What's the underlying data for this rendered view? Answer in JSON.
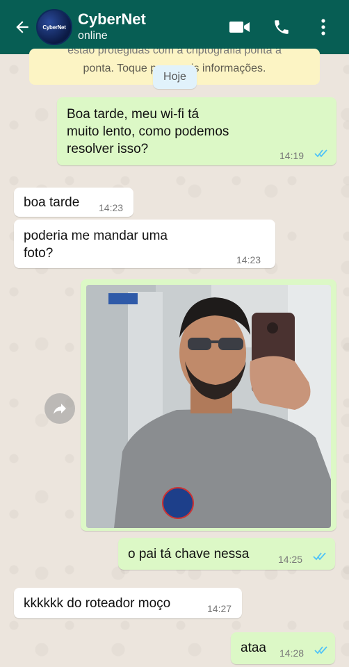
{
  "header": {
    "contact_name": "CyberNet",
    "status": "online",
    "avatar_text": "CyberNet",
    "icons": [
      "back-arrow-icon",
      "video-call-icon",
      "phone-icon",
      "more-vert-icon"
    ],
    "color": "#075e54"
  },
  "notice": {
    "line1": "estão protegidas com a criptografia ponta a",
    "line2": "ponta. Toque para mais informações."
  },
  "date_chip": "Hoje",
  "messages": [
    {
      "direction": "out",
      "lines": [
        "Boa tarde, meu wi-fi tá",
        "muito lento, como podemos",
        "resolver isso?"
      ],
      "time": "14:19",
      "read": true
    },
    {
      "direction": "in",
      "lines": [
        "boa tarde"
      ],
      "time": "14:23"
    },
    {
      "direction": "in",
      "lines": [
        "poderia me mandar uma",
        "foto?"
      ],
      "time": "14:23"
    },
    {
      "direction": "out",
      "type": "photo",
      "description_icon": "mirror-selfie-photo"
    },
    {
      "direction": "out",
      "lines": [
        "o pai tá chave nessa"
      ],
      "time": "14:25",
      "read": true
    },
    {
      "direction": "in",
      "lines": [
        "kkkkkk do roteador moço"
      ],
      "time": "14:27"
    },
    {
      "direction": "out",
      "lines": [
        "ataa"
      ],
      "time": "14:28",
      "read": true
    }
  ],
  "colors": {
    "outgoing_bubble": "#dcf8c6",
    "incoming_bubble": "#ffffff",
    "read_ticks": "#4fc3f7",
    "wallpaper": "#ece5dd"
  }
}
